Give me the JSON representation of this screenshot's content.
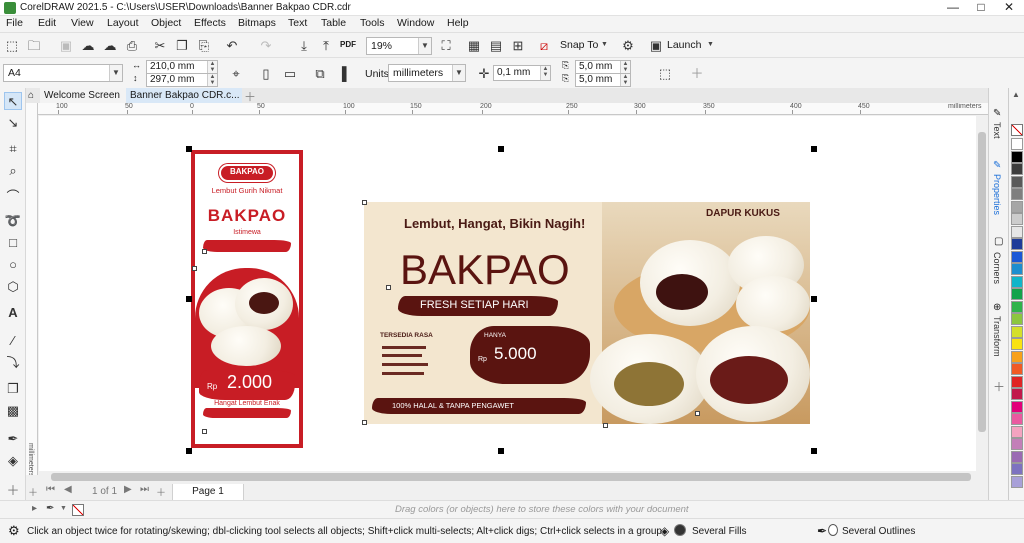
{
  "window": {
    "app_title": "CorelDRAW 2021.5 - C:\\Users\\USER\\Downloads\\Banner Bakpao CDR.cdr",
    "min_glyph": "—",
    "max_glyph": "□",
    "close_glyph": "✕"
  },
  "menu": [
    "File",
    "Edit",
    "View",
    "Layout",
    "Object",
    "Effects",
    "Bitmaps",
    "Text",
    "Table",
    "Tools",
    "Window",
    "Help"
  ],
  "standard_toolbar": {
    "zoom_value": "19%",
    "snap_label": "Snap To",
    "launch_label": "Launch",
    "pdf_label": "PDF"
  },
  "property_bar": {
    "page_size": "A4",
    "width": "210,0 mm",
    "height": "297,0 mm",
    "units_label": "Units:",
    "units_value": "millimeters",
    "nudge": "0,1 mm",
    "dup_x": "5,0 mm",
    "dup_y": "5,0 mm"
  },
  "tabs": {
    "welcome": "Welcome Screen",
    "document": "Banner Bakpao CDR.c..."
  },
  "ruler": {
    "h_labels": [
      "100",
      "50",
      "0",
      "50",
      "100",
      "150",
      "200",
      "250",
      "300",
      "350",
      "400",
      "450"
    ],
    "unit": "millimeters",
    "v_unit": "millimeters"
  },
  "page_nav": {
    "counter": "1 of 1",
    "page_tab": "Page 1"
  },
  "color_bar": {
    "hint": "Drag colors (or objects) here to store these colors with your document"
  },
  "status": {
    "message": "Click an object twice for rotating/skewing; dbl-clicking tool selects all objects; Shift+click multi-selects; Alt+click digs; Ctrl+click selects in a group",
    "fills": "Several Fills",
    "outlines": "Several Outlines"
  },
  "docker_tabs": [
    "Text",
    "Properties",
    "Corners",
    "Transform"
  ],
  "palette_colors": [
    "#ffffff",
    "#000000",
    "#3d3d3d",
    "#595959",
    "#7f7f7f",
    "#a6a6a6",
    "#cccccc",
    "#e6e6e6",
    "#1f3c99",
    "#1a57d6",
    "#1e8ecf",
    "#11b5c9",
    "#13a34a",
    "#2fb34a",
    "#8cc63f",
    "#d4df2a",
    "#f9e311",
    "#f7a11a",
    "#f15a24",
    "#e02424",
    "#c1184a",
    "#e2007a",
    "#ea5aa0",
    "#f4a3c0",
    "#c37fb8",
    "#9a6ab3",
    "#7d72c0",
    "#a8a0d8"
  ],
  "artwork": {
    "banner": {
      "tagline": "Lembut, Hangat, Bikin Nagih!",
      "brand": "DAPUR KUKUS",
      "title": "BAKPAO",
      "subtitle": "FRESH SETIAP HARI",
      "flavors_heading": "TERSEDIA RASA",
      "price_label": "HANYA",
      "currency": "Rp",
      "price": "5.000",
      "footer": "100% HALAL & TANPA PENGAWET"
    },
    "flyer": {
      "logo_text": "BAKPAO",
      "tagline": "Lembut Gurih Nikmat",
      "title": "BAKPAO",
      "subtitle": "Istimewa",
      "currency": "Rp",
      "price": "2.000",
      "footer": "Hangat Lembut Enak"
    }
  }
}
